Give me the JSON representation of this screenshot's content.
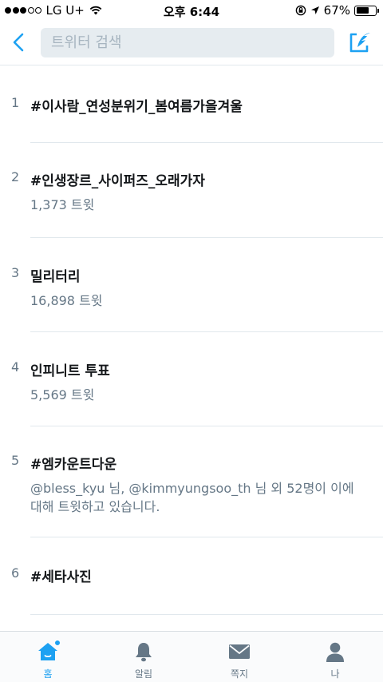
{
  "status": {
    "carrier": "LG U+",
    "time": "오후 6:44",
    "battery": "67%",
    "battery_level": 0.67
  },
  "search": {
    "placeholder": "트위터 검색"
  },
  "trends": [
    {
      "rank": "1",
      "name": "#이사람_연성분위기_봄여름가을겨울",
      "sub": ""
    },
    {
      "rank": "2",
      "name": "#인생장르_사이퍼즈_오래가자",
      "sub": "1,373 트윗"
    },
    {
      "rank": "3",
      "name": "밀리터리",
      "sub": "16,898 트윗"
    },
    {
      "rank": "4",
      "name": "인피니트 투표",
      "sub": "5,569 트윗"
    },
    {
      "rank": "5",
      "name": "#엠카운트다운",
      "sub": "@bless_kyu 님, @kimmyungsoo_th 님 외 52명이 이에 대해 트윗하고 있습니다."
    },
    {
      "rank": "6",
      "name": "#세타사진",
      "sub": ""
    }
  ],
  "tabs": {
    "home": "홈",
    "notifications": "알림",
    "messages": "쪽지",
    "me": "나"
  },
  "colors": {
    "accent": "#1da1f2",
    "icon_gray": "#657786"
  }
}
